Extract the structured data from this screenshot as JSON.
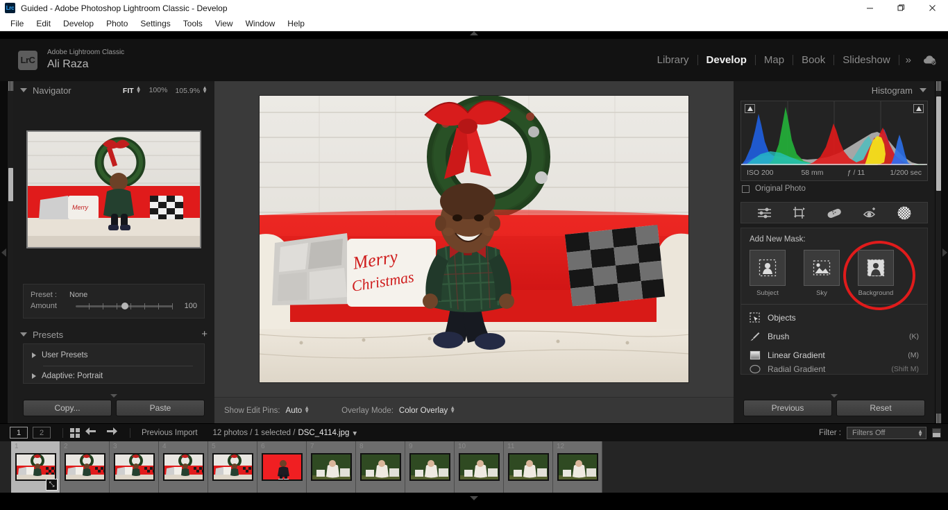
{
  "window": {
    "title": "Guided - Adobe Photoshop Lightroom Classic - Develop",
    "app_badge": "Lrc",
    "minimize": "—",
    "maximize": "❐",
    "close": "✕"
  },
  "menubar": {
    "items": [
      "File",
      "Edit",
      "Develop",
      "Photo",
      "Settings",
      "Tools",
      "View",
      "Window",
      "Help"
    ]
  },
  "identity": {
    "logo": "LrC",
    "app_name": "Adobe Lightroom Classic",
    "user_name": "Ali Raza"
  },
  "modules": {
    "items": [
      "Library",
      "Develop",
      "Map",
      "Book",
      "Slideshow"
    ],
    "active": "Develop",
    "more": "»",
    "cloud_icon": "cloud-off-icon"
  },
  "navigator": {
    "title": "Navigator",
    "fit_label": "FIT",
    "zoom_100": "100%",
    "zoom_custom": "105.9%"
  },
  "preset_amount": {
    "preset_label": "Preset :",
    "preset_value": "None",
    "amount_label": "Amount",
    "amount_value": "100"
  },
  "presets": {
    "title": "Presets",
    "add_label": "+",
    "items": [
      {
        "label": "User Presets"
      },
      {
        "label": "Adaptive: Portrait"
      }
    ]
  },
  "left_buttons": {
    "copy": "Copy...",
    "paste": "Paste"
  },
  "toolbar": {
    "show_edit_pins_label": "Show Edit Pins:",
    "show_edit_pins_value": "Auto",
    "overlay_mode_label": "Overlay Mode:",
    "overlay_mode_value": "Color Overlay"
  },
  "histogram": {
    "title": "Histogram",
    "iso": "ISO 200",
    "focal_length": "58 mm",
    "aperture": "ƒ / 11",
    "shutter": "1/200 sec",
    "original_photo": "Original Photo"
  },
  "tool_strip": {
    "icons": [
      {
        "name": "basic-adjustments-icon",
        "active": false
      },
      {
        "name": "crop-icon",
        "active": false
      },
      {
        "name": "healing-brush-icon",
        "active": false
      },
      {
        "name": "red-eye-icon",
        "active": false
      },
      {
        "name": "masking-icon",
        "active": true
      }
    ]
  },
  "masking": {
    "title": "Add New Mask:",
    "choices": [
      {
        "label": "Subject",
        "icon": "subject-mask-icon"
      },
      {
        "label": "Sky",
        "icon": "sky-mask-icon"
      },
      {
        "label": "Background",
        "icon": "background-mask-icon",
        "highlighted": true
      }
    ],
    "tools": [
      {
        "label": "Objects",
        "shortcut": "",
        "icon": "objects-icon"
      },
      {
        "label": "Brush",
        "shortcut": "(K)",
        "icon": "brush-icon"
      },
      {
        "label": "Linear Gradient",
        "shortcut": "(M)",
        "icon": "linear-gradient-icon"
      },
      {
        "label": "Radial Gradient",
        "shortcut": "(Shift M)",
        "icon": "radial-gradient-icon"
      }
    ],
    "annotation_color": "#e01b1b"
  },
  "right_buttons": {
    "previous": "Previous",
    "reset": "Reset"
  },
  "filmstrip_bar": {
    "page_one": "1",
    "page_two": "2",
    "grid_icon": "grid-view-icon",
    "back_icon": "back-arrow-icon",
    "forward_icon": "forward-arrow-icon",
    "source": "Previous Import",
    "counts": "12 photos  / 1 selected  /",
    "filename": "DSC_4114.jpg",
    "filter_label": "Filter :",
    "filter_value": "Filters Off"
  },
  "filmstrip": {
    "thumbs": [
      {
        "num": "1",
        "kind": "christmas",
        "selected": true,
        "badge": "⤡"
      },
      {
        "num": "2",
        "kind": "christmas",
        "selected": false
      },
      {
        "num": "3",
        "kind": "christmas",
        "selected": false
      },
      {
        "num": "4",
        "kind": "christmas",
        "selected": false
      },
      {
        "num": "5",
        "kind": "christmas",
        "selected": false
      },
      {
        "num": "6",
        "kind": "redbg",
        "selected": false
      },
      {
        "num": "7",
        "kind": "garden",
        "selected": false
      },
      {
        "num": "8",
        "kind": "garden",
        "selected": false
      },
      {
        "num": "9",
        "kind": "garden",
        "selected": false
      },
      {
        "num": "10",
        "kind": "garden",
        "selected": false
      },
      {
        "num": "11",
        "kind": "garden",
        "selected": false
      },
      {
        "num": "12",
        "kind": "garden",
        "selected": false
      }
    ]
  },
  "colors": {
    "accent_red": "#e01b1b",
    "panel_bg": "#1c1c1c",
    "canvas_bg": "#3a3a3a"
  }
}
